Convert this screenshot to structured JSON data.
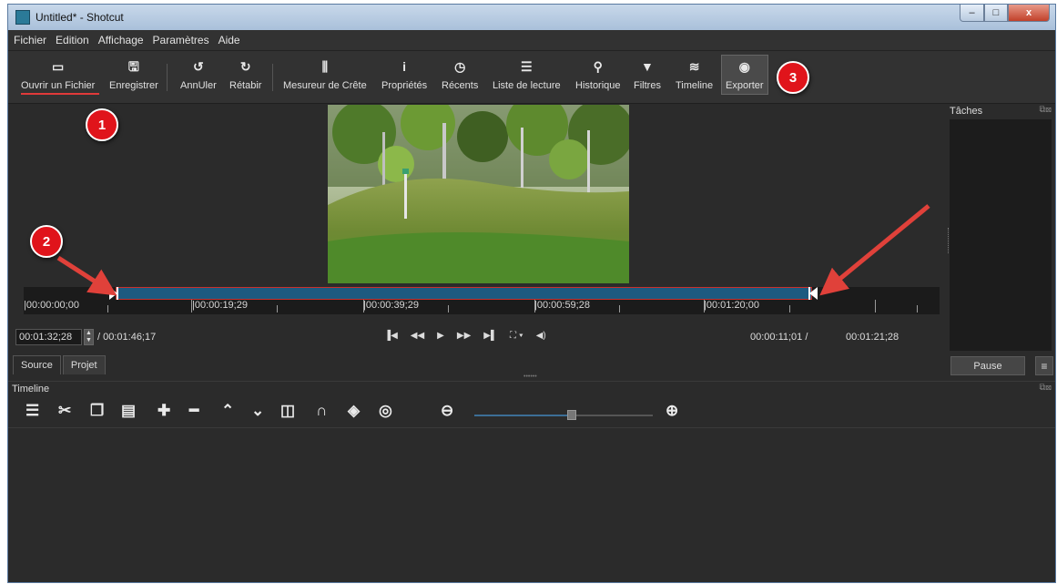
{
  "window": {
    "title": "Untitled* - Shotcut",
    "controls": {
      "minimize": "–",
      "maximize": "□",
      "close": "x"
    }
  },
  "menu": [
    "Fichier",
    "Edition",
    "Affichage",
    "Paramètres",
    "Aide"
  ],
  "toolbar": {
    "items": [
      {
        "label": "Ouvrir un Fichier",
        "icon": "folder-icon"
      },
      {
        "label": "Enregistrer",
        "icon": "save-icon"
      },
      {
        "label": "AnnUler",
        "icon": "undo-icon"
      },
      {
        "label": "Rétabir",
        "icon": "redo-icon"
      },
      {
        "label": "Mesureur de Crête",
        "icon": "peak-meter-icon"
      },
      {
        "label": "Propriétés",
        "icon": "info-icon"
      },
      {
        "label": "Récents",
        "icon": "clock-icon"
      },
      {
        "label": "Liste de lecture",
        "icon": "list-icon"
      },
      {
        "label": "Historique",
        "icon": "history-icon"
      },
      {
        "label": "Filtres",
        "icon": "filter-icon"
      },
      {
        "label": "Timeline",
        "icon": "timeline-icon"
      },
      {
        "label": "Exporter",
        "icon": "export-icon"
      }
    ]
  },
  "player": {
    "ruler_labels": [
      "|00:00:00;00",
      "|00:00:19;29",
      "|00:00:39;29",
      "|00:00:59;28",
      "|00:01:20;00"
    ],
    "timecode": "00:01:32;28",
    "duration": "/ 00:01:46;17",
    "in_point": "00:00:11;01 /",
    "out_point": "00:01:21;28",
    "tabs": [
      "Source",
      "Projet"
    ]
  },
  "tasks": {
    "title": "Tâches",
    "pause_label": "Pause",
    "menu_icon": "≡"
  },
  "timeline": {
    "title": "Timeline"
  },
  "annotations": {
    "badge1": "1",
    "badge2": "2",
    "badge3": "3",
    "arrow_color": "#e0413a",
    "badge_color": "#e0141b"
  }
}
